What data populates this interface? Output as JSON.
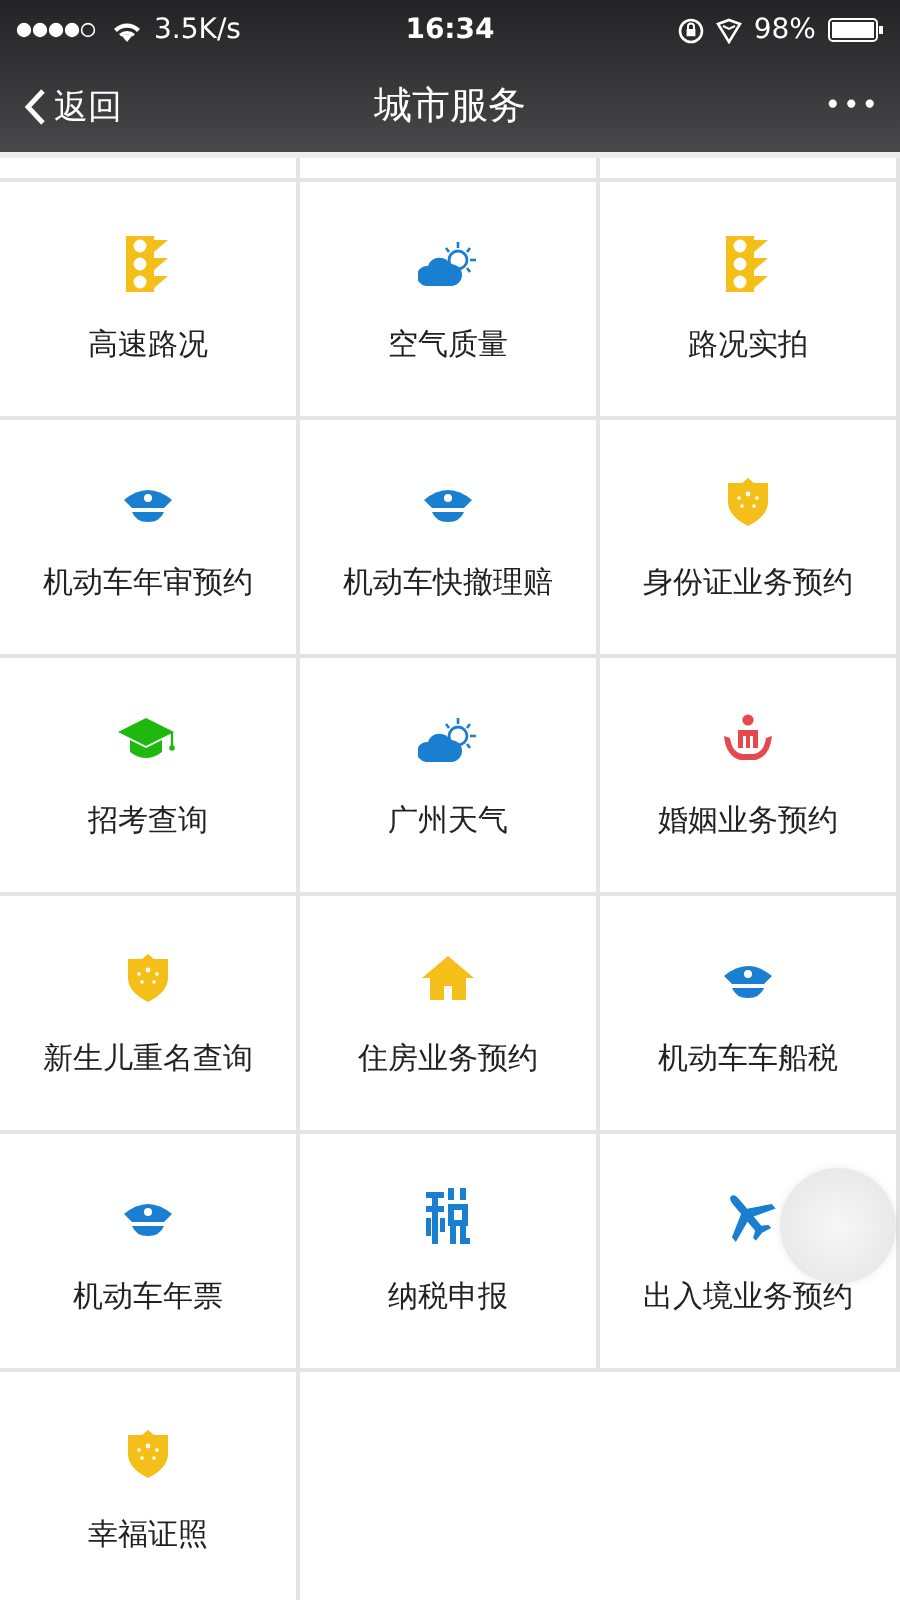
{
  "status_bar": {
    "network_speed": "3.5K/s",
    "time": "16:34",
    "battery": "98%"
  },
  "nav_bar": {
    "back": "返回",
    "title": "城市服务",
    "more": "•••"
  },
  "services": [
    {
      "label": "高速路况",
      "kind": "traffic"
    },
    {
      "label": "空气质量",
      "kind": "weather"
    },
    {
      "label": "路况实拍",
      "kind": "traffic"
    },
    {
      "label": "机动车年审预约",
      "kind": "police"
    },
    {
      "label": "机动车快撤理赔",
      "kind": "police"
    },
    {
      "label": "身份证业务预约",
      "kind": "identity"
    },
    {
      "label": "招考查询",
      "kind": "exam"
    },
    {
      "label": "广州天气",
      "kind": "weather"
    },
    {
      "label": "婚姻业务预约",
      "kind": "marriage"
    },
    {
      "label": "新生儿重名查询",
      "kind": "identity"
    },
    {
      "label": "住房业务预约",
      "kind": "housing"
    },
    {
      "label": "机动车车船税",
      "kind": "police"
    },
    {
      "label": "机动车年票",
      "kind": "police"
    },
    {
      "label": "纳税申报",
      "kind": "tax"
    },
    {
      "label": "出入境业务预约",
      "kind": "travel"
    },
    {
      "label": "幸福证照",
      "kind": "identity"
    }
  ]
}
